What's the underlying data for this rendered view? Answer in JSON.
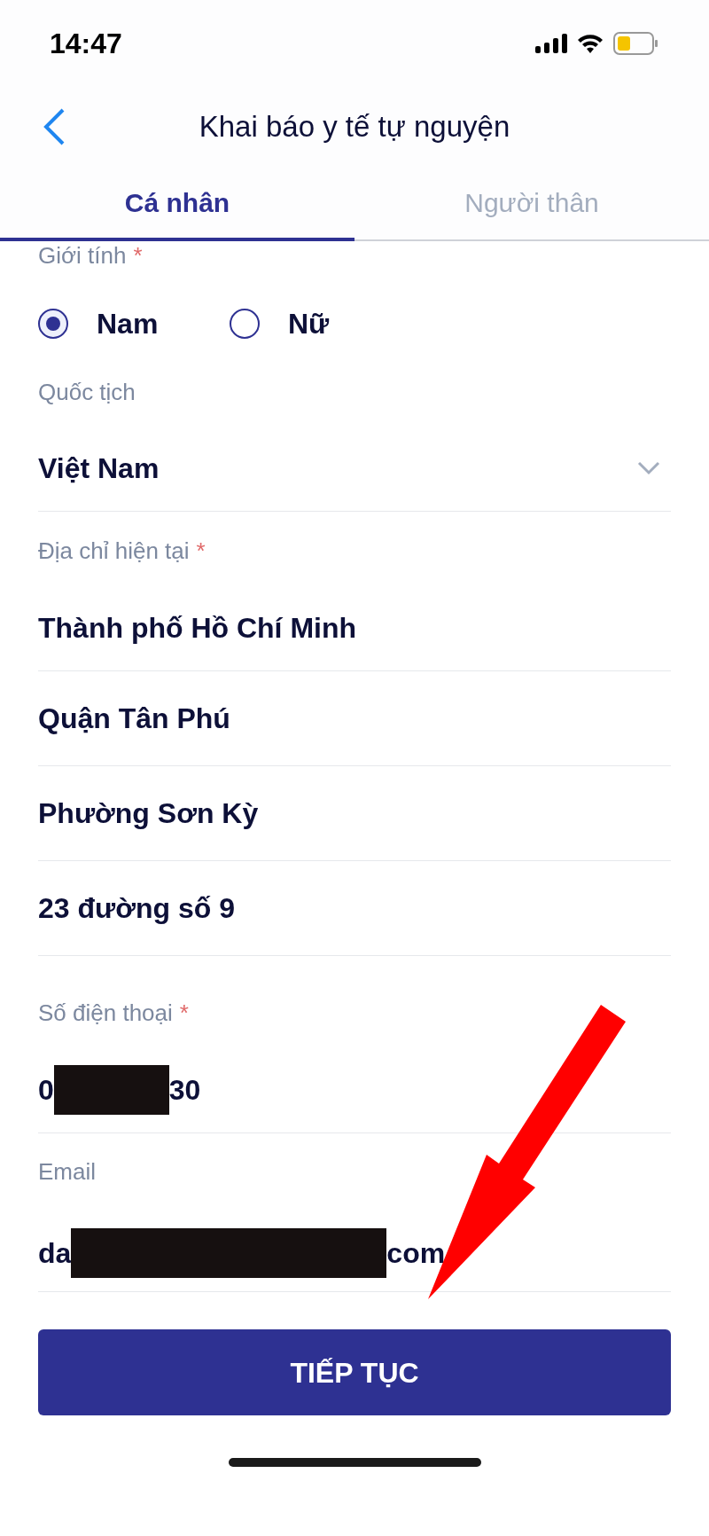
{
  "status_bar": {
    "time": "14:47"
  },
  "header": {
    "title": "Khai báo y tế tự nguyện"
  },
  "tabs": [
    {
      "label": "Cá nhân",
      "selected": true
    },
    {
      "label": "Người thân",
      "selected": false
    }
  ],
  "gender": {
    "label": "Giới tính",
    "required_mark": "*",
    "options": [
      {
        "label": "Nam",
        "selected": true
      },
      {
        "label": "Nữ",
        "selected": false
      }
    ]
  },
  "nationality": {
    "label": "Quốc tịch",
    "value": "Việt Nam"
  },
  "address": {
    "label": "Địa chỉ hiện tại",
    "required_mark": "*",
    "lines": [
      "Thành phố Hồ Chí Minh",
      "Quận Tân Phú",
      "Phường Sơn Kỳ",
      "23 đường số 9"
    ]
  },
  "phone": {
    "label": "Số điện thoại",
    "required_mark": "*",
    "value_start": "0",
    "value_end": "30"
  },
  "email": {
    "label": "Email",
    "value_start": "da",
    "value_end": "com"
  },
  "button": {
    "label": "TIẾP TỤC"
  }
}
